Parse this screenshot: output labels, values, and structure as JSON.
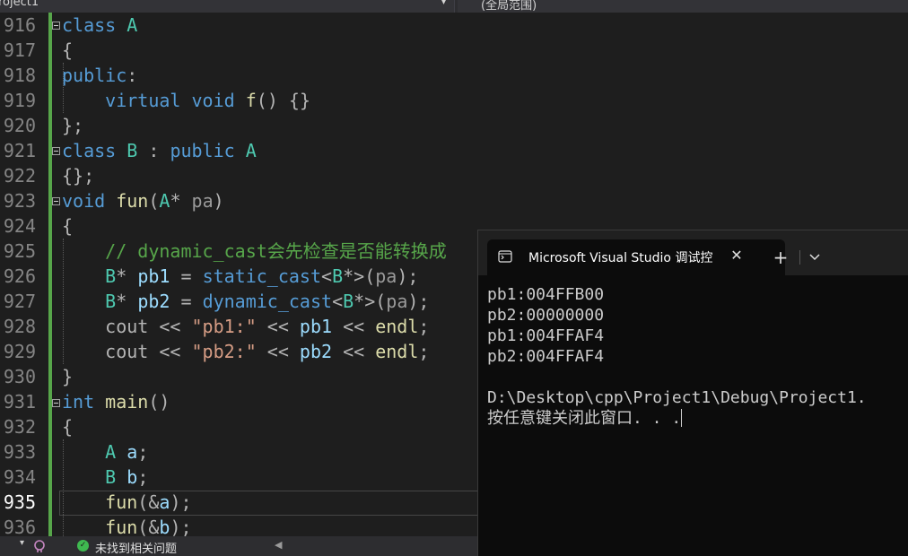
{
  "navbar": {
    "project": "roject1",
    "scope": "(全局范围)"
  },
  "editor": {
    "active_line": "935",
    "lines": [
      {
        "num": "916",
        "parts": [
          {
            "c": "kw",
            "t": "class"
          },
          {
            "c": "pn",
            "t": " "
          },
          {
            "c": "ty",
            "t": "A"
          }
        ]
      },
      {
        "num": "917",
        "parts": [
          {
            "c": "pn",
            "t": "{"
          }
        ]
      },
      {
        "num": "918",
        "parts": [
          {
            "c": "kw",
            "t": "public"
          },
          {
            "c": "pn",
            "t": ":"
          }
        ]
      },
      {
        "num": "919",
        "parts": [
          {
            "c": "pn",
            "t": "    "
          },
          {
            "c": "kw",
            "t": "virtual"
          },
          {
            "c": "pn",
            "t": " "
          },
          {
            "c": "kw",
            "t": "void"
          },
          {
            "c": "pn",
            "t": " "
          },
          {
            "c": "fn",
            "t": "f"
          },
          {
            "c": "pn",
            "t": "() {}"
          }
        ]
      },
      {
        "num": "920",
        "parts": [
          {
            "c": "pn",
            "t": "};"
          }
        ]
      },
      {
        "num": "921",
        "parts": [
          {
            "c": "kw",
            "t": "class"
          },
          {
            "c": "pn",
            "t": " "
          },
          {
            "c": "ty",
            "t": "B"
          },
          {
            "c": "pn",
            "t": " : "
          },
          {
            "c": "kw",
            "t": "public"
          },
          {
            "c": "pn",
            "t": " "
          },
          {
            "c": "ty",
            "t": "A"
          }
        ]
      },
      {
        "num": "922",
        "parts": [
          {
            "c": "pn",
            "t": "{};"
          }
        ]
      },
      {
        "num": "923",
        "parts": [
          {
            "c": "kw",
            "t": "void"
          },
          {
            "c": "pn",
            "t": " "
          },
          {
            "c": "fn",
            "t": "fun"
          },
          {
            "c": "pn",
            "t": "("
          },
          {
            "c": "ty",
            "t": "A"
          },
          {
            "c": "pn",
            "t": "* "
          },
          {
            "c": "pm",
            "t": "pa"
          },
          {
            "c": "pn",
            "t": ")"
          }
        ]
      },
      {
        "num": "924",
        "parts": [
          {
            "c": "pn",
            "t": "{"
          }
        ]
      },
      {
        "num": "925",
        "parts": [
          {
            "c": "pn",
            "t": "    "
          },
          {
            "c": "cm",
            "t": "// dynamic_cast会先检查是否能转换成"
          }
        ]
      },
      {
        "num": "926",
        "parts": [
          {
            "c": "pn",
            "t": "    "
          },
          {
            "c": "ty",
            "t": "B"
          },
          {
            "c": "pn",
            "t": "* "
          },
          {
            "c": "vr",
            "t": "pb1"
          },
          {
            "c": "pn",
            "t": " = "
          },
          {
            "c": "kw",
            "t": "static_cast"
          },
          {
            "c": "pn",
            "t": "<"
          },
          {
            "c": "ty",
            "t": "B"
          },
          {
            "c": "pn",
            "t": "*>("
          },
          {
            "c": "pm",
            "t": "pa"
          },
          {
            "c": "pn",
            "t": ");"
          }
        ]
      },
      {
        "num": "927",
        "parts": [
          {
            "c": "pn",
            "t": "    "
          },
          {
            "c": "ty",
            "t": "B"
          },
          {
            "c": "pn",
            "t": "* "
          },
          {
            "c": "vr",
            "t": "pb2"
          },
          {
            "c": "pn",
            "t": " = "
          },
          {
            "c": "kw",
            "t": "dynamic_cast"
          },
          {
            "c": "pn",
            "t": "<"
          },
          {
            "c": "ty",
            "t": "B"
          },
          {
            "c": "pn",
            "t": "*>("
          },
          {
            "c": "pm",
            "t": "pa"
          },
          {
            "c": "pn",
            "t": ");"
          }
        ]
      },
      {
        "num": "928",
        "parts": [
          {
            "c": "pn",
            "t": "    "
          },
          {
            "c": "pn",
            "t": "cout << "
          },
          {
            "c": "st",
            "t": "\"pb1:\""
          },
          {
            "c": "pn",
            "t": " << "
          },
          {
            "c": "vr",
            "t": "pb1"
          },
          {
            "c": "pn",
            "t": " << "
          },
          {
            "c": "fn",
            "t": "endl"
          },
          {
            "c": "pn",
            "t": ";"
          }
        ]
      },
      {
        "num": "929",
        "parts": [
          {
            "c": "pn",
            "t": "    "
          },
          {
            "c": "pn",
            "t": "cout << "
          },
          {
            "c": "st",
            "t": "\"pb2:\""
          },
          {
            "c": "pn",
            "t": " << "
          },
          {
            "c": "vr",
            "t": "pb2"
          },
          {
            "c": "pn",
            "t": " << "
          },
          {
            "c": "fn",
            "t": "endl"
          },
          {
            "c": "pn",
            "t": ";"
          }
        ]
      },
      {
        "num": "930",
        "parts": [
          {
            "c": "pn",
            "t": "}"
          }
        ]
      },
      {
        "num": "931",
        "parts": [
          {
            "c": "kw",
            "t": "int"
          },
          {
            "c": "pn",
            "t": " "
          },
          {
            "c": "fn",
            "t": "main"
          },
          {
            "c": "pn",
            "t": "()"
          }
        ]
      },
      {
        "num": "932",
        "parts": [
          {
            "c": "pn",
            "t": "{"
          }
        ]
      },
      {
        "num": "933",
        "parts": [
          {
            "c": "pn",
            "t": "    "
          },
          {
            "c": "ty",
            "t": "A"
          },
          {
            "c": "pn",
            "t": " "
          },
          {
            "c": "vr",
            "t": "a"
          },
          {
            "c": "pn",
            "t": ";"
          }
        ]
      },
      {
        "num": "934",
        "parts": [
          {
            "c": "pn",
            "t": "    "
          },
          {
            "c": "ty",
            "t": "B"
          },
          {
            "c": "pn",
            "t": " "
          },
          {
            "c": "vr",
            "t": "b"
          },
          {
            "c": "pn",
            "t": ";"
          }
        ]
      },
      {
        "num": "935",
        "parts": [
          {
            "c": "pn",
            "t": "    "
          },
          {
            "c": "fn",
            "t": "fun"
          },
          {
            "c": "pn",
            "t": "(&"
          },
          {
            "c": "vr",
            "t": "a"
          },
          {
            "c": "pn",
            "t": ");"
          }
        ]
      },
      {
        "num": "936",
        "parts": [
          {
            "c": "pn",
            "t": "    "
          },
          {
            "c": "fn",
            "t": "fun"
          },
          {
            "c": "pn",
            "t": "(&"
          },
          {
            "c": "vr",
            "t": "b"
          },
          {
            "c": "pn",
            "t": ");"
          }
        ]
      }
    ]
  },
  "statusbar": {
    "message": "未找到相关问题"
  },
  "terminal": {
    "title": "Microsoft Visual Studio 调试控制台",
    "output": [
      "pb1:004FFB00",
      "pb2:00000000",
      "pb1:004FFAF4",
      "pb2:004FFAF4",
      "",
      "D:\\Desktop\\cpp\\Project1\\Debug\\Project1.",
      "按任意键关闭此窗口. . ."
    ]
  },
  "colors": {
    "keyword": "#569cd6",
    "type": "#4ec9b0",
    "function": "#dcdcaa",
    "variable": "#9cdcfe",
    "string": "#d69d85",
    "comment": "#57a64a"
  }
}
